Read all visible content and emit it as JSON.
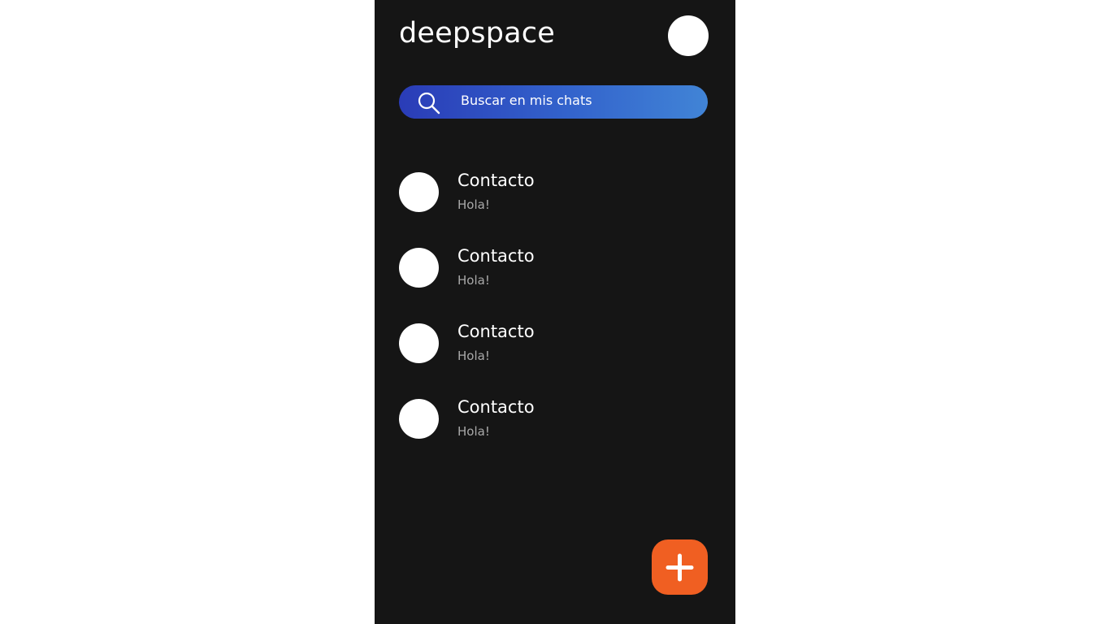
{
  "app": {
    "title": "deepspace"
  },
  "search": {
    "placeholder": "Buscar en mis chats",
    "icon": "search-icon"
  },
  "chats": [
    {
      "name": "Contacto",
      "preview": "Hola!"
    },
    {
      "name": "Contacto",
      "preview": "Hola!"
    },
    {
      "name": "Contacto",
      "preview": "Hola!"
    },
    {
      "name": "Contacto",
      "preview": "Hola!"
    }
  ],
  "fab": {
    "icon": "plus-icon"
  },
  "colors": {
    "background": "#151515",
    "search_gradient_start": "#2a3cb7",
    "search_gradient_end": "#4184d6",
    "fab": "#f05f22",
    "secondary_text": "#a9a9a9"
  }
}
